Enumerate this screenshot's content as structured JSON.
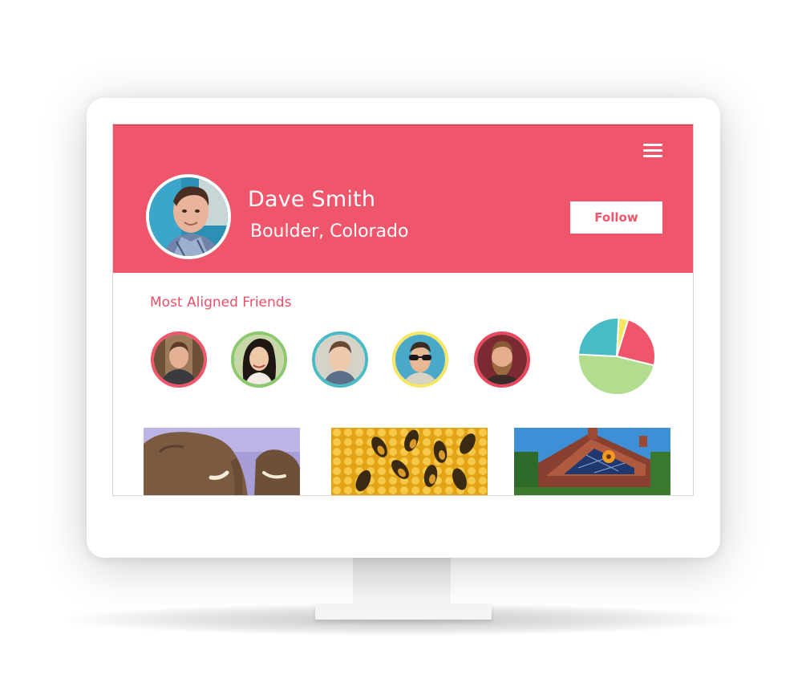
{
  "profile": {
    "name": "Dave Smith",
    "location": "Boulder, Colorado",
    "follow_label": "Follow"
  },
  "icons": {
    "menu": "hamburger-menu-icon",
    "profile_photo": "avatar",
    "friend_photo": "avatar"
  },
  "friends_section": {
    "title": "Most Aligned Friends",
    "friends": [
      {
        "border_color": "#ef566c"
      },
      {
        "border_color": "#8cc96e"
      },
      {
        "border_color": "#47bcc4"
      },
      {
        "border_color": "#f5e663"
      },
      {
        "border_color": "#e8475e"
      }
    ]
  },
  "alignment_chart": {
    "type": "pie",
    "slices": [
      {
        "value": 4,
        "color": "#f5e663"
      },
      {
        "value": 24,
        "color": "#ef566c"
      },
      {
        "value": 47,
        "color": "#b2dc8e"
      },
      {
        "value": 25,
        "color": "#47bcc4"
      }
    ]
  },
  "colors": {
    "brand": "#ef566c",
    "white": "#ffffff"
  },
  "feed": {
    "photos": [
      "elephant-photo",
      "honeybee-photo",
      "solar-house-photo"
    ]
  }
}
